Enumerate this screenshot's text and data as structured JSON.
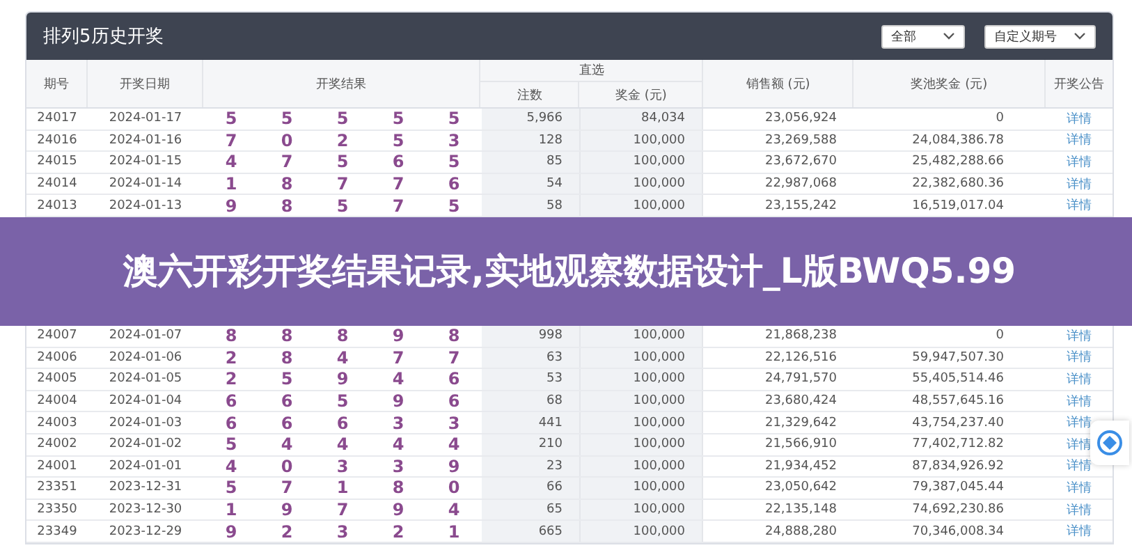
{
  "panel": {
    "title": "排列5历史开奖",
    "filters": [
      {
        "label": "全部"
      },
      {
        "label": "自定义期号"
      }
    ]
  },
  "table": {
    "columns": {
      "issue": "期号",
      "date": "开奖日期",
      "result": "开奖结果",
      "direct": "直选",
      "count": "注数",
      "prize": "奖金 (元)",
      "sales": "销售额 (元)",
      "pool": "奖池奖金 (元)",
      "notice": "开奖公告"
    },
    "rows_top": [
      {
        "issue": "24017",
        "date": "2024-01-17",
        "digits": [
          "5",
          "5",
          "5",
          "5",
          "5"
        ],
        "count": "5,966",
        "prize": "84,034",
        "sales": "23,056,924",
        "pool": "0",
        "link": "详情"
      },
      {
        "issue": "24016",
        "date": "2024-01-16",
        "digits": [
          "7",
          "0",
          "2",
          "5",
          "3"
        ],
        "count": "128",
        "prize": "100,000",
        "sales": "23,269,588",
        "pool": "24,084,386.78",
        "link": "详情"
      },
      {
        "issue": "24015",
        "date": "2024-01-15",
        "digits": [
          "4",
          "7",
          "5",
          "6",
          "5"
        ],
        "count": "85",
        "prize": "100,000",
        "sales": "23,672,670",
        "pool": "25,482,288.66",
        "link": "详情"
      },
      {
        "issue": "24014",
        "date": "2024-01-14",
        "digits": [
          "1",
          "8",
          "7",
          "7",
          "6"
        ],
        "count": "54",
        "prize": "100,000",
        "sales": "22,987,068",
        "pool": "22,382,680.36",
        "link": "详情"
      },
      {
        "issue": "24013",
        "date": "2024-01-13",
        "digits": [
          "9",
          "8",
          "5",
          "7",
          "5"
        ],
        "count": "58",
        "prize": "100,000",
        "sales": "23,155,242",
        "pool": "16,519,017.04",
        "link": "详情"
      }
    ],
    "rows_bottom": [
      {
        "issue": "24007",
        "date": "2024-01-07",
        "digits": [
          "8",
          "8",
          "8",
          "9",
          "8"
        ],
        "count": "998",
        "prize": "100,000",
        "sales": "21,868,238",
        "pool": "0",
        "link": "详情"
      },
      {
        "issue": "24006",
        "date": "2024-01-06",
        "digits": [
          "2",
          "8",
          "4",
          "7",
          "7"
        ],
        "count": "63",
        "prize": "100,000",
        "sales": "22,126,516",
        "pool": "59,947,507.30",
        "link": "详情"
      },
      {
        "issue": "24005",
        "date": "2024-01-05",
        "digits": [
          "2",
          "5",
          "9",
          "4",
          "6"
        ],
        "count": "53",
        "prize": "100,000",
        "sales": "24,791,570",
        "pool": "55,405,514.46",
        "link": "详情"
      },
      {
        "issue": "24004",
        "date": "2024-01-04",
        "digits": [
          "6",
          "6",
          "5",
          "9",
          "6"
        ],
        "count": "68",
        "prize": "100,000",
        "sales": "23,680,424",
        "pool": "48,557,645.16",
        "link": "详情"
      },
      {
        "issue": "24003",
        "date": "2024-01-03",
        "digits": [
          "6",
          "6",
          "6",
          "3",
          "3"
        ],
        "count": "441",
        "prize": "100,000",
        "sales": "21,329,642",
        "pool": "43,754,237.40",
        "link": "详情"
      },
      {
        "issue": "24002",
        "date": "2024-01-02",
        "digits": [
          "5",
          "4",
          "4",
          "4",
          "4"
        ],
        "count": "210",
        "prize": "100,000",
        "sales": "21,566,910",
        "pool": "77,402,712.82",
        "link": "详情"
      },
      {
        "issue": "24001",
        "date": "2024-01-01",
        "digits": [
          "4",
          "0",
          "3",
          "3",
          "9"
        ],
        "count": "23",
        "prize": "100,000",
        "sales": "21,934,452",
        "pool": "87,834,926.92",
        "link": "详情"
      },
      {
        "issue": "23351",
        "date": "2023-12-31",
        "digits": [
          "5",
          "7",
          "1",
          "8",
          "0"
        ],
        "count": "66",
        "prize": "100,000",
        "sales": "23,050,642",
        "pool": "79,387,045.44",
        "link": "详情"
      },
      {
        "issue": "23350",
        "date": "2023-12-30",
        "digits": [
          "1",
          "9",
          "7",
          "9",
          "4"
        ],
        "count": "65",
        "prize": "100,000",
        "sales": "22,135,148",
        "pool": "74,692,230.86",
        "link": "详情"
      },
      {
        "issue": "23349",
        "date": "2023-12-29",
        "digits": [
          "9",
          "2",
          "3",
          "2",
          "1"
        ],
        "count": "665",
        "prize": "100,000",
        "sales": "24,888,280",
        "pool": "70,346,008.34",
        "link": "详情"
      }
    ]
  },
  "banner": {
    "text": "澳六开彩开奖结果记录,实地观察数据设计_L版BWQ5.99"
  }
}
